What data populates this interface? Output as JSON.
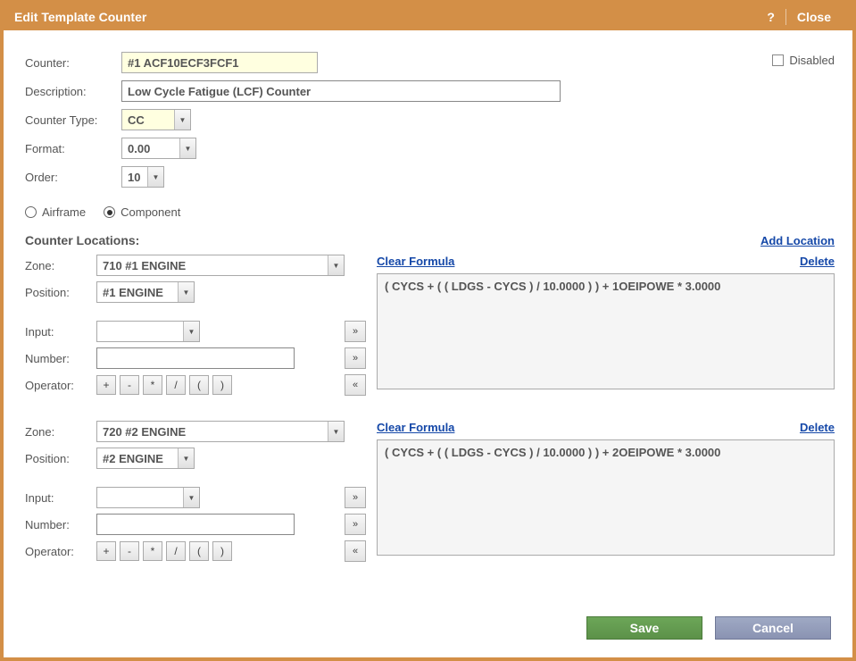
{
  "dialog": {
    "title": "Edit Template Counter",
    "help": "?",
    "close": "Close"
  },
  "form": {
    "counter_label": "Counter:",
    "counter_value": "#1 ACF10ECF3FCF1",
    "description_label": "Description:",
    "description_value": "Low Cycle Fatigue (LCF) Counter",
    "counter_type_label": "Counter Type:",
    "counter_type_value": "CC",
    "format_label": "Format:",
    "format_value": "0.00",
    "order_label": "Order:",
    "order_value": "10",
    "disabled_label": "Disabled"
  },
  "scope": {
    "airframe": "Airframe",
    "component": "Component",
    "selected": "component"
  },
  "locations_header": {
    "title": "Counter Locations:",
    "add": "Add Location"
  },
  "shared": {
    "zone_label": "Zone:",
    "position_label": "Position:",
    "input_label": "Input:",
    "number_label": "Number:",
    "operator_label": "Operator:",
    "clear_formula": "Clear Formula",
    "delete": "Delete",
    "insert": "»",
    "remove": "«",
    "ops": [
      "+",
      "-",
      "*",
      "/",
      "(",
      ")"
    ]
  },
  "locations": [
    {
      "zone": "710 #1 ENGINE",
      "position": "#1 ENGINE",
      "input": "",
      "number": "",
      "formula": "( CYCS + ( ( LDGS - CYCS ) / 10.0000 ) ) + 1OEIPOWE * 3.0000"
    },
    {
      "zone": "720 #2 ENGINE",
      "position": "#2 ENGINE",
      "input": "",
      "number": "",
      "formula": "( CYCS + ( ( LDGS - CYCS ) / 10.0000 ) ) + 2OEIPOWE * 3.0000"
    }
  ],
  "footer": {
    "save": "Save",
    "cancel": "Cancel"
  }
}
